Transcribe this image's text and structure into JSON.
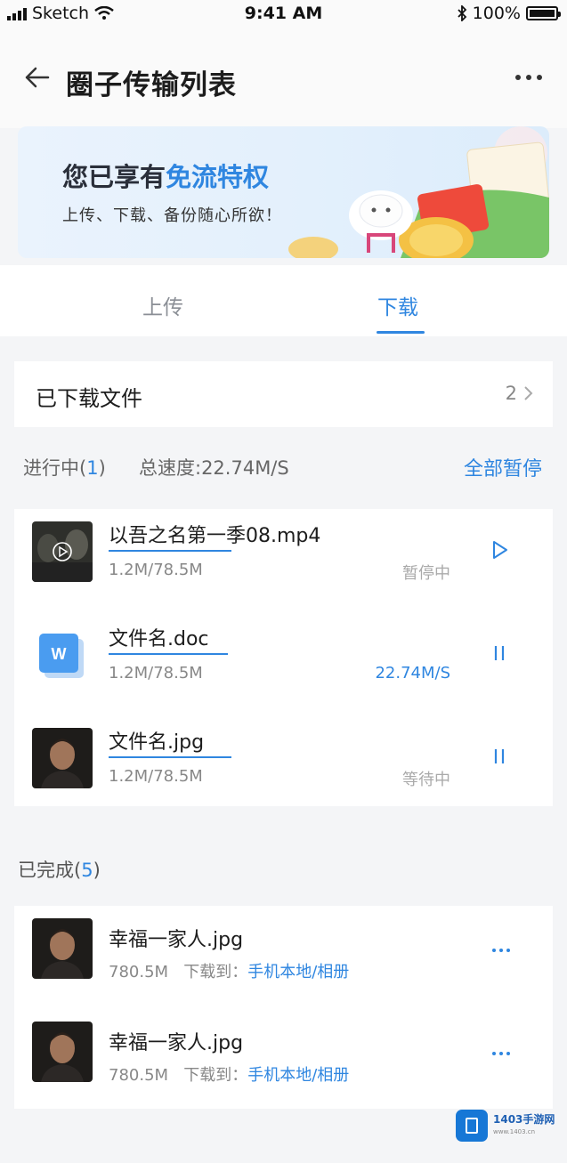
{
  "status_bar": {
    "carrier": "Sketch",
    "time": "9:41 AM",
    "battery": "100%"
  },
  "header": {
    "title": "圈子传输列表"
  },
  "banner": {
    "headline_prefix": "您已享有",
    "headline_highlight": "免流特权",
    "subtitle": "上传、下载、备份随心所欲！"
  },
  "tabs": [
    {
      "label": "上传",
      "active": false
    },
    {
      "label": "下载",
      "active": true
    }
  ],
  "downloaded_files": {
    "label": "已下载文件",
    "count": "2"
  },
  "in_progress": {
    "label": "进行中",
    "count": "1",
    "speed_label": "总速度:22.74M/S",
    "pause_all": "全部暂停"
  },
  "active_items": [
    {
      "name": "以吾之名第一季08.mp4",
      "size": "1.2M/78.5M",
      "status": "暂停中",
      "action": "play",
      "thumb": "video"
    },
    {
      "name": "文件名.doc",
      "size": "1.2M/78.5M",
      "status": "22.74M/S",
      "action": "pause",
      "thumb": "doc"
    },
    {
      "name": "文件名.jpg",
      "size": "1.2M/78.5M",
      "status": "等待中",
      "action": "pause",
      "thumb": "photo"
    }
  ],
  "completed": {
    "label": "已完成",
    "count": "5",
    "items": [
      {
        "name": "幸福一家人.jpg",
        "size": "780.5M",
        "dest_label": "下载到：",
        "dest": "手机本地/相册"
      },
      {
        "name": "幸福一家人.jpg",
        "size": "780.5M",
        "dest_label": "下载到：",
        "dest": "手机本地/相册"
      }
    ]
  },
  "watermark": {
    "site": "1403手游网",
    "url": "www.1403.cn"
  },
  "colors": {
    "accent": "#2f86e0",
    "background": "#f4f5f7"
  }
}
